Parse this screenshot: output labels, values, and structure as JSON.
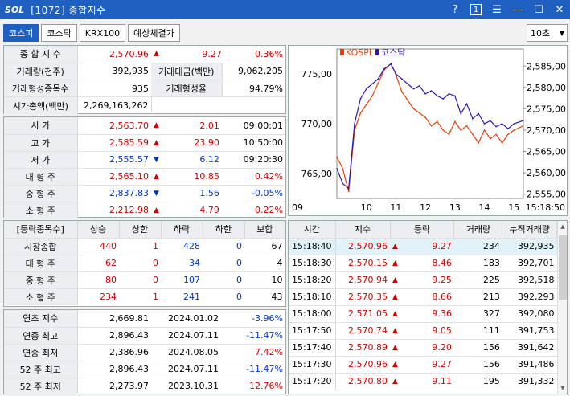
{
  "window": {
    "logo": "SOL",
    "title": "[1072] 종합지수",
    "help": "?",
    "one": "1",
    "menu": "☰",
    "minimize": "—",
    "maximize": "☐",
    "close": "✕"
  },
  "tabs": [
    {
      "label": "코스피"
    },
    {
      "label": "코스닥"
    },
    {
      "label": "KRX100"
    },
    {
      "label": "예상체결가"
    }
  ],
  "interval": {
    "value": "10초"
  },
  "summary": {
    "index_label": "종 합 지 수",
    "index_value": "2,570.96",
    "change_value": "9.27",
    "change_rate": "0.36%",
    "volume_label": "거래량(천주)",
    "volume_value": "392,935",
    "amount_label": "거래대금(백만)",
    "amount_value": "9,062,205",
    "formed_count_label": "거래형성종목수",
    "formed_count_value": "935",
    "formed_rate_label": "거래형성율",
    "formed_rate_value": "94.79%",
    "market_cap_label": "시가총액(백만)",
    "market_cap_value": "2,269,163,262"
  },
  "ohlc": [
    {
      "label": "시    가",
      "value": "2,563.70",
      "dir": "up",
      "change": "2.01",
      "extra": "09:00:01"
    },
    {
      "label": "고    가",
      "value": "2,585.59",
      "dir": "up",
      "change": "23.90",
      "extra": "10:50:00"
    },
    {
      "label": "저    가",
      "value": "2,555.57",
      "dir": "dn",
      "change": "6.12",
      "extra": "09:20:30"
    },
    {
      "label": "대 형 주",
      "value": "2,565.10",
      "dir": "up",
      "change": "10.85",
      "extra": "0.42%"
    },
    {
      "label": "중 형 주",
      "value": "2,837.83",
      "dir": "dn",
      "change": "1.56",
      "extra": "-0.05%"
    },
    {
      "label": "소 형 주",
      "value": "2,212.98",
      "dir": "up",
      "change": "4.79",
      "extra": "0.22%"
    }
  ],
  "breadth": {
    "headers": [
      "[등락종목수]",
      "상승",
      "상한",
      "하락",
      "하한",
      "보합"
    ],
    "rows": [
      {
        "label": "시장종합",
        "up": "440",
        "upper": "1",
        "down": "428",
        "lower": "0",
        "flat": "67"
      },
      {
        "label": "대 형 주",
        "up": "62",
        "upper": "0",
        "down": "34",
        "lower": "0",
        "flat": "4"
      },
      {
        "label": "중 형 주",
        "up": "80",
        "upper": "0",
        "down": "107",
        "lower": "0",
        "flat": "10"
      },
      {
        "label": "소 형 주",
        "up": "234",
        "upper": "1",
        "down": "241",
        "lower": "0",
        "flat": "43"
      }
    ]
  },
  "highs_lows": [
    {
      "label": "연초  지수",
      "value": "2,669.81",
      "date": "2024.01.02",
      "rate": "-3.96%"
    },
    {
      "label": "연중  최고",
      "value": "2,896.43",
      "date": "2024.07.11",
      "rate": "-11.47%"
    },
    {
      "label": "연중  최저",
      "value": "2,386.96",
      "date": "2024.08.05",
      "rate": "7.42%"
    },
    {
      "label": "52 주 최고",
      "value": "2,896.43",
      "date": "2024.07.11",
      "rate": "-11.47%"
    },
    {
      "label": "52 주 최저",
      "value": "2,273.97",
      "date": "2023.10.31",
      "rate": "12.76%"
    }
  ],
  "ticks": {
    "headers": [
      "시간",
      "지수",
      "등락",
      "거래량",
      "누적거래량"
    ],
    "rows": [
      {
        "time": "15:18:40",
        "index": "2,570.96",
        "change": "9.27",
        "volume": "234",
        "cum_volume": "392,935"
      },
      {
        "time": "15:18:30",
        "index": "2,570.15",
        "change": "8.46",
        "volume": "183",
        "cum_volume": "392,701"
      },
      {
        "time": "15:18:20",
        "index": "2,570.94",
        "change": "9.25",
        "volume": "225",
        "cum_volume": "392,518"
      },
      {
        "time": "15:18:10",
        "index": "2,570.35",
        "change": "8.66",
        "volume": "213",
        "cum_volume": "392,293"
      },
      {
        "time": "15:18:00",
        "index": "2,571.05",
        "change": "9.36",
        "volume": "327",
        "cum_volume": "392,080"
      },
      {
        "time": "15:17:50",
        "index": "2,570.74",
        "change": "9.05",
        "volume": "111",
        "cum_volume": "391,753"
      },
      {
        "time": "15:17:40",
        "index": "2,570.89",
        "change": "9.20",
        "volume": "156",
        "cum_volume": "391,642"
      },
      {
        "time": "15:17:30",
        "index": "2,570.96",
        "change": "9.27",
        "volume": "156",
        "cum_volume": "391,486"
      },
      {
        "time": "15:17:20",
        "index": "2,570.80",
        "change": "9.11",
        "volume": "195",
        "cum_volume": "391,332"
      }
    ]
  },
  "colors": {
    "up": "#d40000",
    "down": "#0036c8",
    "kospi_line": "#f03c00",
    "kosdaq_line": "#2a18b8",
    "title_bar": "#1f5fbf"
  },
  "chart_data": {
    "type": "line",
    "legend": [
      "KOSPI",
      "코스닥"
    ],
    "x_ticks": [
      "09",
      "10",
      "11",
      "12",
      "13",
      "14",
      "15",
      "15:18:50"
    ],
    "left_axis": {
      "ticks": [
        "775,00",
        "770,00",
        "765,00"
      ],
      "range": [
        762.5,
        777.5
      ]
    },
    "right_axis": {
      "ticks": [
        "2,585,00",
        "2,580,00",
        "2,575,00",
        "2,570,00",
        "2,565,00",
        "2,560,00",
        "2,555,00"
      ],
      "range": [
        2554,
        2589
      ]
    },
    "series": [
      {
        "name": "KOSPI",
        "axis": "right",
        "x": [
          9.0,
          9.2,
          9.4,
          9.6,
          9.8,
          10.0,
          10.2,
          10.4,
          10.6,
          10.83,
          11.0,
          11.2,
          11.4,
          11.6,
          11.8,
          12.0,
          12.2,
          12.4,
          12.6,
          12.8,
          13.0,
          13.2,
          13.4,
          13.6,
          13.8,
          14.0,
          14.2,
          14.4,
          14.6,
          14.8,
          15.0,
          15.3
        ],
        "values": [
          2563.7,
          2561,
          2555.6,
          2570,
          2574,
          2576,
          2578,
          2581,
          2584,
          2585.6,
          2583,
          2579,
          2577,
          2575,
          2574,
          2573,
          2571,
          2572,
          2570,
          2569,
          2572,
          2570,
          2571,
          2569,
          2567,
          2570,
          2568,
          2569,
          2567,
          2569,
          2570,
          2570.96
        ]
      },
      {
        "name": "코스닥",
        "axis": "left",
        "x": [
          9.0,
          9.2,
          9.4,
          9.6,
          9.8,
          10.0,
          10.2,
          10.4,
          10.6,
          10.83,
          11.0,
          11.2,
          11.4,
          11.6,
          11.8,
          12.0,
          12.2,
          12.4,
          12.6,
          12.8,
          13.0,
          13.2,
          13.4,
          13.6,
          13.8,
          14.0,
          14.2,
          14.4,
          14.6,
          14.8,
          15.0,
          15.3
        ],
        "values": [
          765.5,
          764,
          763.5,
          770,
          772.5,
          773.5,
          774,
          774.5,
          775.5,
          776,
          775,
          774.5,
          774,
          773.5,
          773.8,
          773,
          773.3,
          772.8,
          772.5,
          773,
          772.8,
          771,
          772,
          770.5,
          771,
          770,
          770.3,
          769.7,
          770,
          769.5,
          770,
          770.3
        ]
      }
    ]
  }
}
